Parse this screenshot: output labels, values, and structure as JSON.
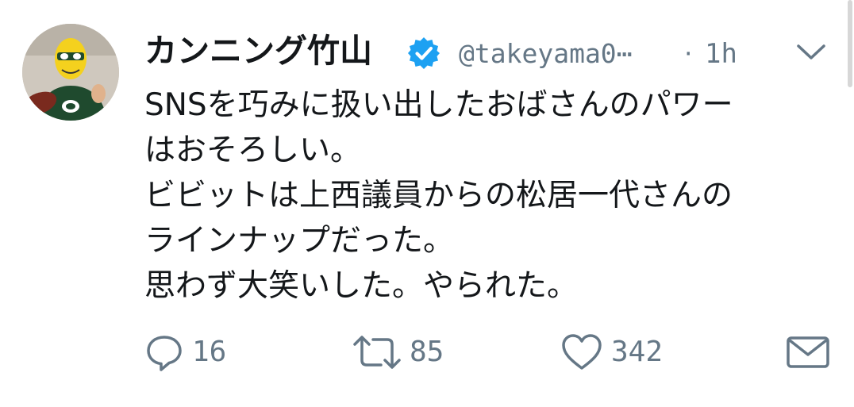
{
  "tweet": {
    "display_name": "カンニング竹山",
    "verified": true,
    "handle": "@takeyama0⋯",
    "separator": "·",
    "time": "1h",
    "body_lines": [
      "SNSを巧みに扱い出したおばさんのパワー",
      "はおそろしい。",
      "ビビットは上西議員からの松居一代さんの",
      "ラインナップだった。",
      "思わず大笑いした。やられた。"
    ],
    "reply_count": "16",
    "retweet_count": "85",
    "like_count": "342"
  },
  "icons": {
    "verified": "verified-badge-icon",
    "menu": "chevron-down-icon",
    "reply": "reply-icon",
    "retweet": "retweet-icon",
    "like": "heart-icon",
    "dm": "envelope-icon"
  },
  "colors": {
    "text": "#14171a",
    "secondary": "#657786",
    "verified": "#1da1f2"
  }
}
